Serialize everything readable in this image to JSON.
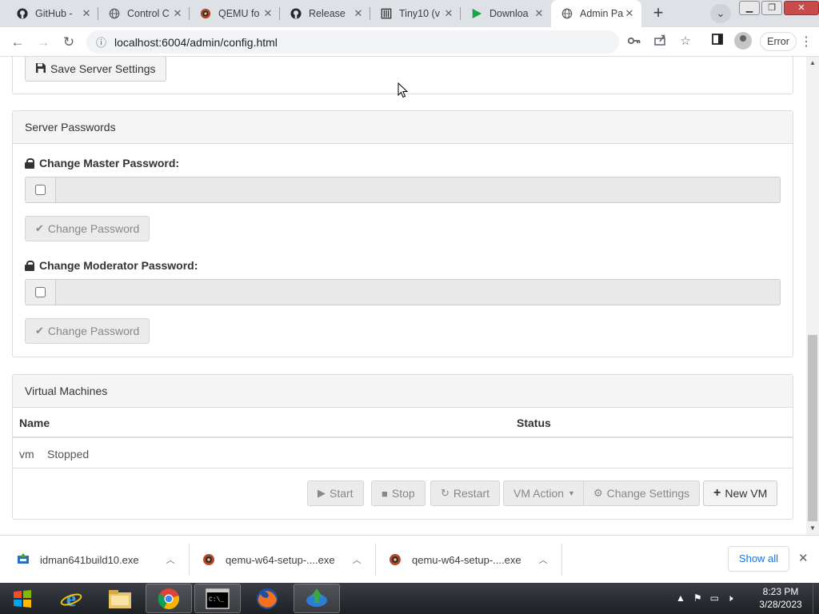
{
  "browser": {
    "tabs": [
      {
        "title": "GitHub - ",
        "icon": "github-icon"
      },
      {
        "title": "Control C",
        "icon": "globe-icon"
      },
      {
        "title": "QEMU fo",
        "icon": "qemu-icon"
      },
      {
        "title": "Release",
        "icon": "github-icon"
      },
      {
        "title": "Tiny10 (v",
        "icon": "archive-icon"
      },
      {
        "title": "Downloa",
        "icon": "play-icon"
      },
      {
        "title": "Admin Pa",
        "icon": "globe-icon"
      }
    ],
    "url": "localhost:6004/admin/config.html",
    "error_label": "Error",
    "window_controls": {
      "minimize": "▁",
      "maximize": "❐",
      "close": "✕"
    }
  },
  "page": {
    "save_button": "Save Server Settings",
    "passwords": {
      "heading": "Server Passwords",
      "master_label": "Change Master Password:",
      "master_button": "Change Password",
      "moderator_label": "Change Moderator Password:",
      "moderator_button": "Change Password"
    },
    "vms": {
      "heading": "Virtual Machines",
      "columns": [
        "Name",
        "Status"
      ],
      "rows": [
        {
          "name": "vm",
          "status": "Stopped"
        }
      ],
      "actions": {
        "start": "Start",
        "stop": "Stop",
        "restart": "Restart",
        "vm_action": "VM Action",
        "change_settings": "Change Settings",
        "new_vm": "New VM"
      }
    }
  },
  "downloads": {
    "items": [
      {
        "name": "idman641build10.exe"
      },
      {
        "name": "qemu-w64-setup-....exe"
      },
      {
        "name": "qemu-w64-setup-....exe"
      }
    ],
    "show_all": "Show all"
  },
  "taskbar": {
    "time": "8:23 PM",
    "date": "3/28/2023"
  }
}
